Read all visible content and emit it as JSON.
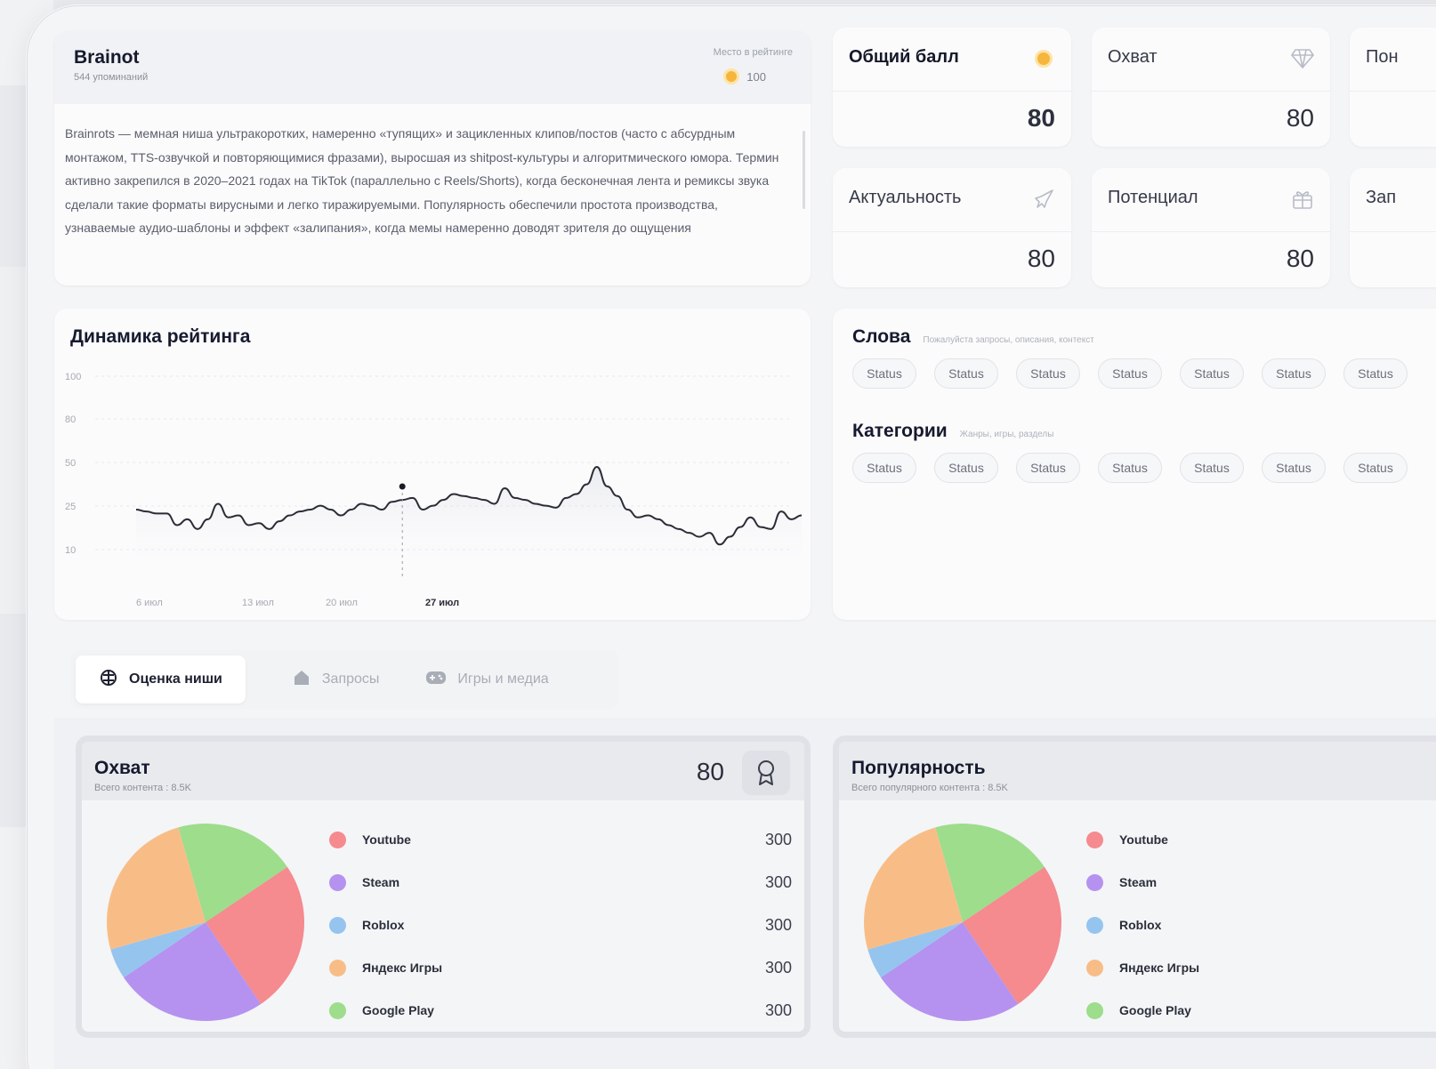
{
  "colors": {
    "youtube": "#f58a8f",
    "steam": "#b592ef",
    "roblox": "#95c4ef",
    "yandex": "#f8bd87",
    "googleplay": "#9ddd8c",
    "coin": "#f6b53c",
    "line": "#2b2d36"
  },
  "info": {
    "title": "Brainot",
    "mentions": "544  упоминаний",
    "rank_label": "Место в рейтинге",
    "rank_value": "100",
    "description": "Brainrots — мемная ниша ультракоротких, намеренно «тупящих» и зацикленных клипов/постов (часто с абсурдным монтажом, TTS-озвучкой и повторяющимися фразами), выросшая из shitpost-культуры и алгоритмического юмора. Термин активно закрепился в 2020–2021 годах на TikTok (параллельно с Reels/Shorts), когда бесконечная лента и ремиксы звука сделали такие форматы вирусными и легко тиражируемыми. Популярность обеспечили простота производства, узнаваемые аудио-шаблоны и эффект «залипания», когда мемы намеренно доводят зрителя до ощущения"
  },
  "metrics": [
    {
      "label": "Общий балл",
      "value": "80",
      "icon": "coin-icon"
    },
    {
      "label": "Охват",
      "value": "80",
      "icon": "diamond-icon"
    },
    {
      "label": "Пон",
      "value": "",
      "icon": ""
    },
    {
      "label": "Актуальность",
      "value": "80",
      "icon": "rocket-icon"
    },
    {
      "label": "Потенциал",
      "value": "80",
      "icon": "gift-icon"
    },
    {
      "label": "Зап",
      "value": "",
      "icon": ""
    }
  ],
  "chart_data": {
    "type": "line",
    "title": "Динамика рейтинга",
    "y_ticks": [
      "100",
      "80",
      "50",
      "25",
      "10"
    ],
    "x_ticks": [
      "6 июл",
      "13 июл",
      "20 июл",
      "27 июл"
    ],
    "active_x": "27 июл",
    "ylim": [
      0,
      110
    ],
    "grid": true,
    "values": [
      22,
      21,
      20,
      20,
      14,
      17,
      12,
      17,
      25,
      18,
      19,
      14,
      15,
      12,
      16,
      19,
      21,
      22,
      24,
      22,
      19,
      22,
      25,
      24,
      22,
      26,
      27,
      28,
      22,
      24,
      27,
      30,
      29,
      28,
      27,
      25,
      33,
      28,
      27,
      25,
      24,
      23,
      28,
      30,
      35,
      44,
      34,
      29,
      22,
      18,
      19,
      17,
      14,
      12,
      10,
      8,
      10,
      4,
      8,
      13,
      18,
      13,
      12,
      21,
      17,
      19
    ],
    "marker_index": 26,
    "marker_value": 30
  },
  "words": {
    "title": "Слова",
    "hint": "Пожалуйста запросы, описания, контекст",
    "tags": [
      "Status",
      "Status",
      "Status",
      "Status",
      "Status",
      "Status",
      "Status"
    ]
  },
  "categories": {
    "title": "Категории",
    "hint": "Жанры, игры, разделы",
    "tags": [
      "Status",
      "Status",
      "Status",
      "Status",
      "Status",
      "Status",
      "Status"
    ]
  },
  "tabs": [
    {
      "label": "Оценка ниши",
      "icon": "brain-icon"
    },
    {
      "label": "Запросы",
      "icon": "home-icon"
    },
    {
      "label": "Игры и медиа",
      "icon": "gamepad-icon"
    }
  ],
  "reach": {
    "title": "Охват",
    "subtitle": "Всего контента : 8.5K",
    "score": "80",
    "badge_icon": "award-icon"
  },
  "popularity": {
    "title": "Популярность",
    "subtitle": "Всего популярного контента : 8.5K"
  },
  "legend": [
    {
      "name": "Youtube",
      "value": "300",
      "color": "#f58a8f"
    },
    {
      "name": "Steam",
      "value": "300",
      "color": "#b592ef"
    },
    {
      "name": "Roblox",
      "value": "300",
      "color": "#95c4ef"
    },
    {
      "name": "Яндекс Игры",
      "value": "300",
      "color": "#f8bd87"
    },
    {
      "name": "Google Play",
      "value": "300",
      "color": "#9ddd8c"
    }
  ],
  "pie_shares": [
    0.25,
    0.25,
    0.05,
    0.25,
    0.2
  ]
}
